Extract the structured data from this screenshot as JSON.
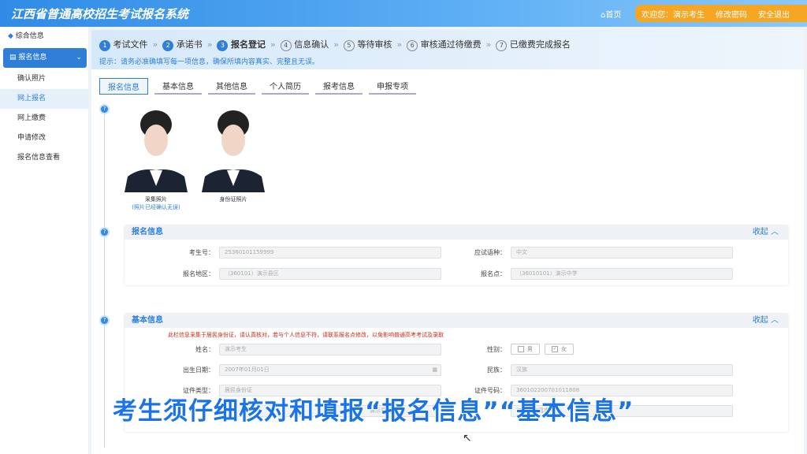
{
  "header": {
    "title": "江西省普通高校招生考试报名系统",
    "home": "首页",
    "welcome": "欢迎您：演示考生",
    "change_password": "修改密码",
    "logout": "安全退出"
  },
  "sidebar": {
    "overview": "综合信息",
    "group": "报名信息",
    "items": [
      "确认照片",
      "网上报名",
      "网上缴费",
      "申请修改",
      "报名信息查看"
    ],
    "selected": "网上报名"
  },
  "steps": [
    {
      "n": "1",
      "label": "考试文件",
      "state": "done"
    },
    {
      "n": "2",
      "label": "承诺书",
      "state": "done"
    },
    {
      "n": "3",
      "label": "报名登记",
      "state": "current"
    },
    {
      "n": "4",
      "label": "信息确认",
      "state": "todo"
    },
    {
      "n": "5",
      "label": "等待审核",
      "state": "todo"
    },
    {
      "n": "6",
      "label": "审核通过待缴费",
      "state": "todo"
    },
    {
      "n": "7",
      "label": "已缴费完成报名",
      "state": "todo"
    }
  ],
  "tip": "提示：请务必准确填写每一项信息，确保所填内容真实、完整且无误。",
  "tabs": [
    "报名信息",
    "基本信息",
    "其他信息",
    "个人简历",
    "报考信息",
    "申报专项"
  ],
  "photos": {
    "collected": "采集照片",
    "collected_note": "(照片已经确认无误)",
    "id": "身份证照片"
  },
  "reg": {
    "title": "报名信息",
    "collapse": "收起",
    "fields": [
      {
        "label": "考生号：",
        "value": "25360101159999"
      },
      {
        "label": "应试语种：",
        "value": "中文"
      },
      {
        "label": "报名地区：",
        "value": "（360101）演示县区"
      },
      {
        "label": "报名点：",
        "value": "（36010101）演示中学"
      }
    ]
  },
  "basic": {
    "title": "基本信息",
    "collapse": "收起",
    "warning": "此栏信息采集于居民身份证，请认真核对，若与个人信息不符，请联系报名点修改，以免影响普通高考考试及录取",
    "name_label": "姓名：",
    "name": "演示考生",
    "gender_label": "性别：",
    "male": "男",
    "female": "女",
    "birth_label": "出生日期：",
    "birth": "2007年01月01日",
    "ethnic_label": "民族：",
    "ethnic": "汉族",
    "idtype_label": "证件类型：",
    "idtype": "居民身份证",
    "idno_label": "证件号码：",
    "idno": "360102200701011808",
    "county": "演示县区",
    "address": "江西省南昌市"
  },
  "subtitle": "考生须仔细核对和填报“报名信息”“基本信息”",
  "colors": {
    "primary": "#2f7fd8",
    "accent": "#f5a623",
    "warning": "#d0281b"
  }
}
